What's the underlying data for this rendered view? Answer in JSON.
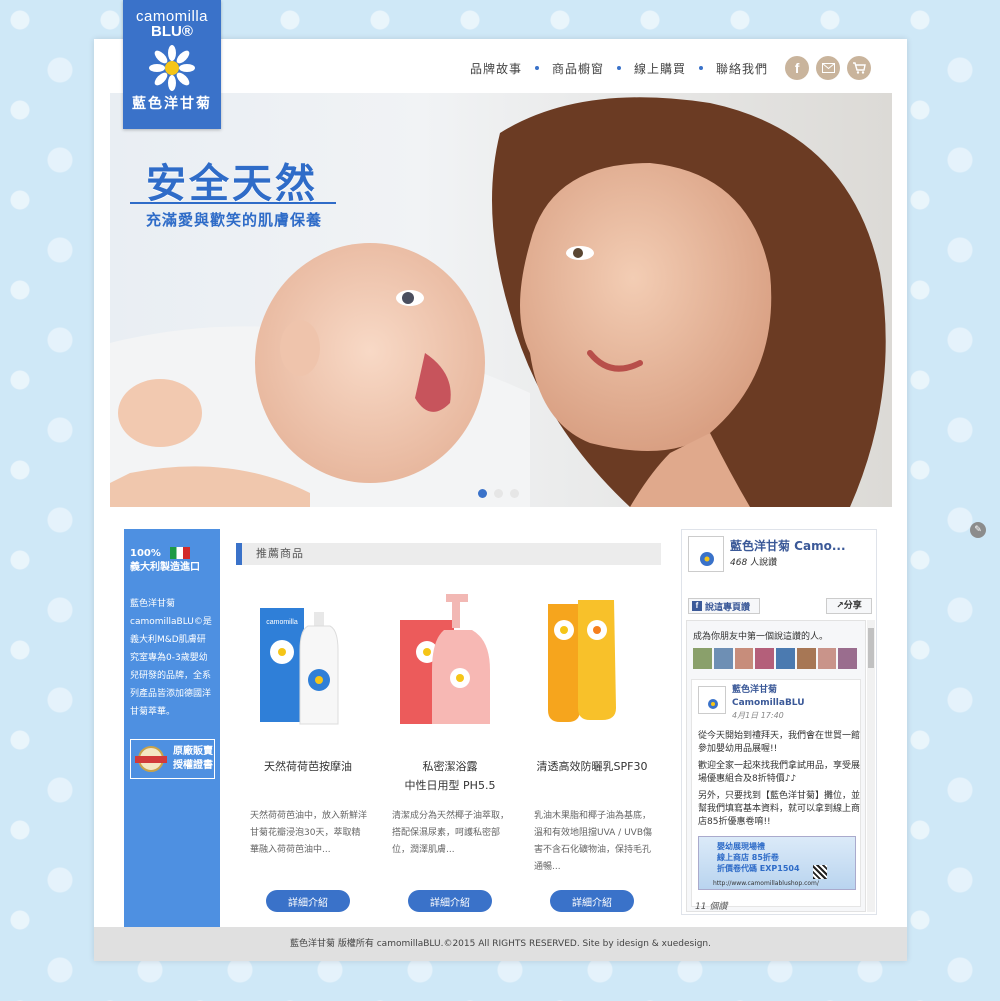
{
  "logo": {
    "line1": "camomilla",
    "line2": "BLU®",
    "name": "藍色洋甘菊"
  },
  "nav": {
    "items": [
      "品牌故事",
      "商品櫥窗",
      "線上購買",
      "聯絡我們"
    ],
    "icons": [
      "facebook-icon",
      "mail-icon",
      "cart-icon"
    ]
  },
  "hero": {
    "title": "安全天然",
    "subtitle": "充滿愛與歡笑的肌膚保養",
    "slides": 3,
    "active_slide": 1
  },
  "side": {
    "heading_line1": "100%",
    "heading_line2": "義大利製造進口",
    "body": "藍色洋甘菊camomillaBLU©是義大利M&D肌膚研究室專為0-3歲嬰幼兒研發的品牌，全系列產品皆添加德國洋甘菊萃華。",
    "cert_line1": "原廠販賣",
    "cert_line2": "授權證書"
  },
  "featured": {
    "heading": "推薦商品",
    "button_label": "詳細介紹",
    "products": [
      {
        "name_line1": "天然荷荷芭按摩油",
        "name_line2": "",
        "desc": "天然荷荷芭油中，放入新鮮洋甘菊花瓣浸泡30天，萃取精華融入荷荷芭油中..."
      },
      {
        "name_line1": "私密潔浴露",
        "name_line2": "中性日用型 PH5.5",
        "desc": "清潔成分為天然椰子油萃取，搭配保濕尿素，呵護私密部位，潤澤肌膚..."
      },
      {
        "name_line1": "清透高效防曬乳SPF30",
        "name_line2": "",
        "desc": "乳油木果脂和椰子油為基底，溫和有效地阻擋UVA / UVB傷害不含石化礦物油，保持毛孔通暢..."
      }
    ]
  },
  "facebook": {
    "page_title": "藍色洋甘菊 Camo...",
    "likes_count": "468",
    "likes_suffix": "人說讚",
    "like_button": "說這專頁讚",
    "share_button": "分享",
    "friends_text": "成為你朋友中第一個說這讚的人。",
    "post_author_line1": "藍色洋甘菊",
    "post_author_line2": "CamomillaBLU",
    "post_date": "4月1日 17:40",
    "post_p1": "從今天開始到禮拜天，我們會在世貿一館參加嬰幼用品展喔!!",
    "post_p2": "歡迎全家一起來找我們拿試用品，享受展場優惠組合及8折特價♪♪",
    "post_p3": "另外，只要找到【藍色洋甘菊】攤位，並幫我們填寫基本資料，就可以拿到線上商店85折優惠卷唷!!",
    "banner_line1": "嬰幼展現場禮",
    "banner_line2": "線上商店 85折卷",
    "banner_line3": "折價卷代碼 EXP1504",
    "banner_url": "http://www.camomillablushop.com/",
    "reads": "11 個讚"
  },
  "footer": {
    "text": "藍色洋甘菊 版權所有 camomillaBLU.©2015 All RIGHTS RESERVED. Site by idesign & xuedesign."
  }
}
